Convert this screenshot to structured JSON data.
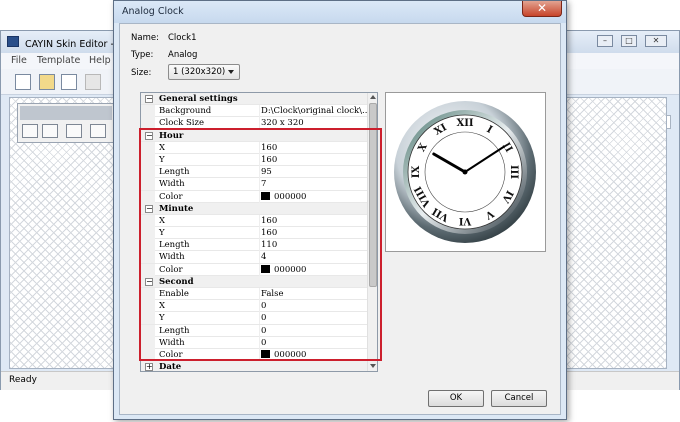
{
  "background_window": {
    "title": "CAYIN Skin Editor - 未",
    "menu": [
      "File",
      "Template",
      "Help"
    ],
    "status": "Ready"
  },
  "dialog": {
    "title": "Analog Clock",
    "close_glyph": "✕",
    "name_label": "Name:",
    "name_value": "Clock1",
    "type_label": "Type:",
    "type_value": "Analog",
    "size_label": "Size:",
    "size_value": "1  (320x320)",
    "ok_label": "OK",
    "cancel_label": "Cancel"
  },
  "properties": [
    {
      "kind": "category",
      "label": "General settings",
      "toggle": "−"
    },
    {
      "kind": "prop",
      "key": "Background",
      "value": "D:\\Clock\\original clock\\..."
    },
    {
      "kind": "prop",
      "key": "Clock Size",
      "value": "320 x 320"
    },
    {
      "kind": "category",
      "label": "Hour",
      "toggle": "−"
    },
    {
      "kind": "prop",
      "key": "X",
      "value": "160"
    },
    {
      "kind": "prop",
      "key": "Y",
      "value": "160"
    },
    {
      "kind": "prop",
      "key": "Length",
      "value": "95"
    },
    {
      "kind": "prop",
      "key": "Width",
      "value": "7"
    },
    {
      "kind": "prop",
      "key": "Color",
      "value": "000000",
      "swatch": "#000000"
    },
    {
      "kind": "category",
      "label": "Minute",
      "toggle": "−"
    },
    {
      "kind": "prop",
      "key": "X",
      "value": "160"
    },
    {
      "kind": "prop",
      "key": "Y",
      "value": "160"
    },
    {
      "kind": "prop",
      "key": "Length",
      "value": "110"
    },
    {
      "kind": "prop",
      "key": "Width",
      "value": "4"
    },
    {
      "kind": "prop",
      "key": "Color",
      "value": "000000",
      "swatch": "#000000"
    },
    {
      "kind": "category",
      "label": "Second",
      "toggle": "−"
    },
    {
      "kind": "prop",
      "key": "Enable",
      "value": "False"
    },
    {
      "kind": "prop",
      "key": "X",
      "value": "0"
    },
    {
      "kind": "prop",
      "key": "Y",
      "value": "0"
    },
    {
      "kind": "prop",
      "key": "Length",
      "value": "0"
    },
    {
      "kind": "prop",
      "key": "Width",
      "value": "0"
    },
    {
      "kind": "prop",
      "key": "Color",
      "value": "000000",
      "swatch": "#000000"
    },
    {
      "kind": "category",
      "label": "Date",
      "toggle": "+"
    }
  ],
  "clock_preview": {
    "numerals": [
      "XII",
      "I",
      "II",
      "III",
      "IV",
      "V",
      "VI",
      "VII",
      "VIII",
      "IX",
      "X",
      "XI"
    ],
    "hour_hand_angle_deg": 300,
    "minute_hand_angle_deg": 57
  },
  "colors": {
    "highlight_border": "#cc1f2d",
    "dialog_frame": "#dce8f5",
    "close_button": "#c7442a"
  }
}
